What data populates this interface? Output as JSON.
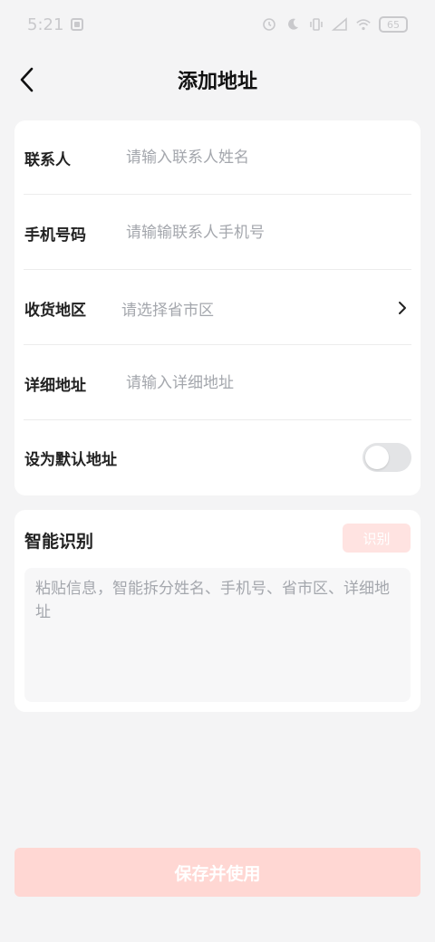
{
  "status_bar": {
    "time": "5:21",
    "battery": "65",
    "icons": [
      "notification-square-icon",
      "alarm-icon",
      "moon-icon",
      "vibrate-icon",
      "signal-icon",
      "wifi-icon",
      "battery-icon"
    ]
  },
  "header": {
    "title": "添加地址",
    "back_icon": "back-arrow-icon"
  },
  "form": {
    "contact": {
      "label": "联系人",
      "placeholder": "请输入联系人姓名",
      "value": ""
    },
    "phone": {
      "label": "手机号码",
      "placeholder": "请输输联系人手机号",
      "value": ""
    },
    "region": {
      "label": "收货地区",
      "placeholder": "请选择省市区",
      "icon": "chevron-right-icon"
    },
    "detail": {
      "label": "详细地址",
      "placeholder": "请输入详细地址",
      "value": ""
    },
    "default": {
      "label": "设为默认地址",
      "enabled": false
    }
  },
  "smart": {
    "title": "智能识别",
    "button_label": "识别",
    "placeholder": "粘贴信息，智能拆分姓名、手机号、省市区、详细地址"
  },
  "footer": {
    "save_label": "保存并使用"
  },
  "colors": {
    "background": "#f4f4f5",
    "card": "#ffffff",
    "primary_disabled": "#ffd7d3",
    "placeholder": "#a4a7ad"
  }
}
